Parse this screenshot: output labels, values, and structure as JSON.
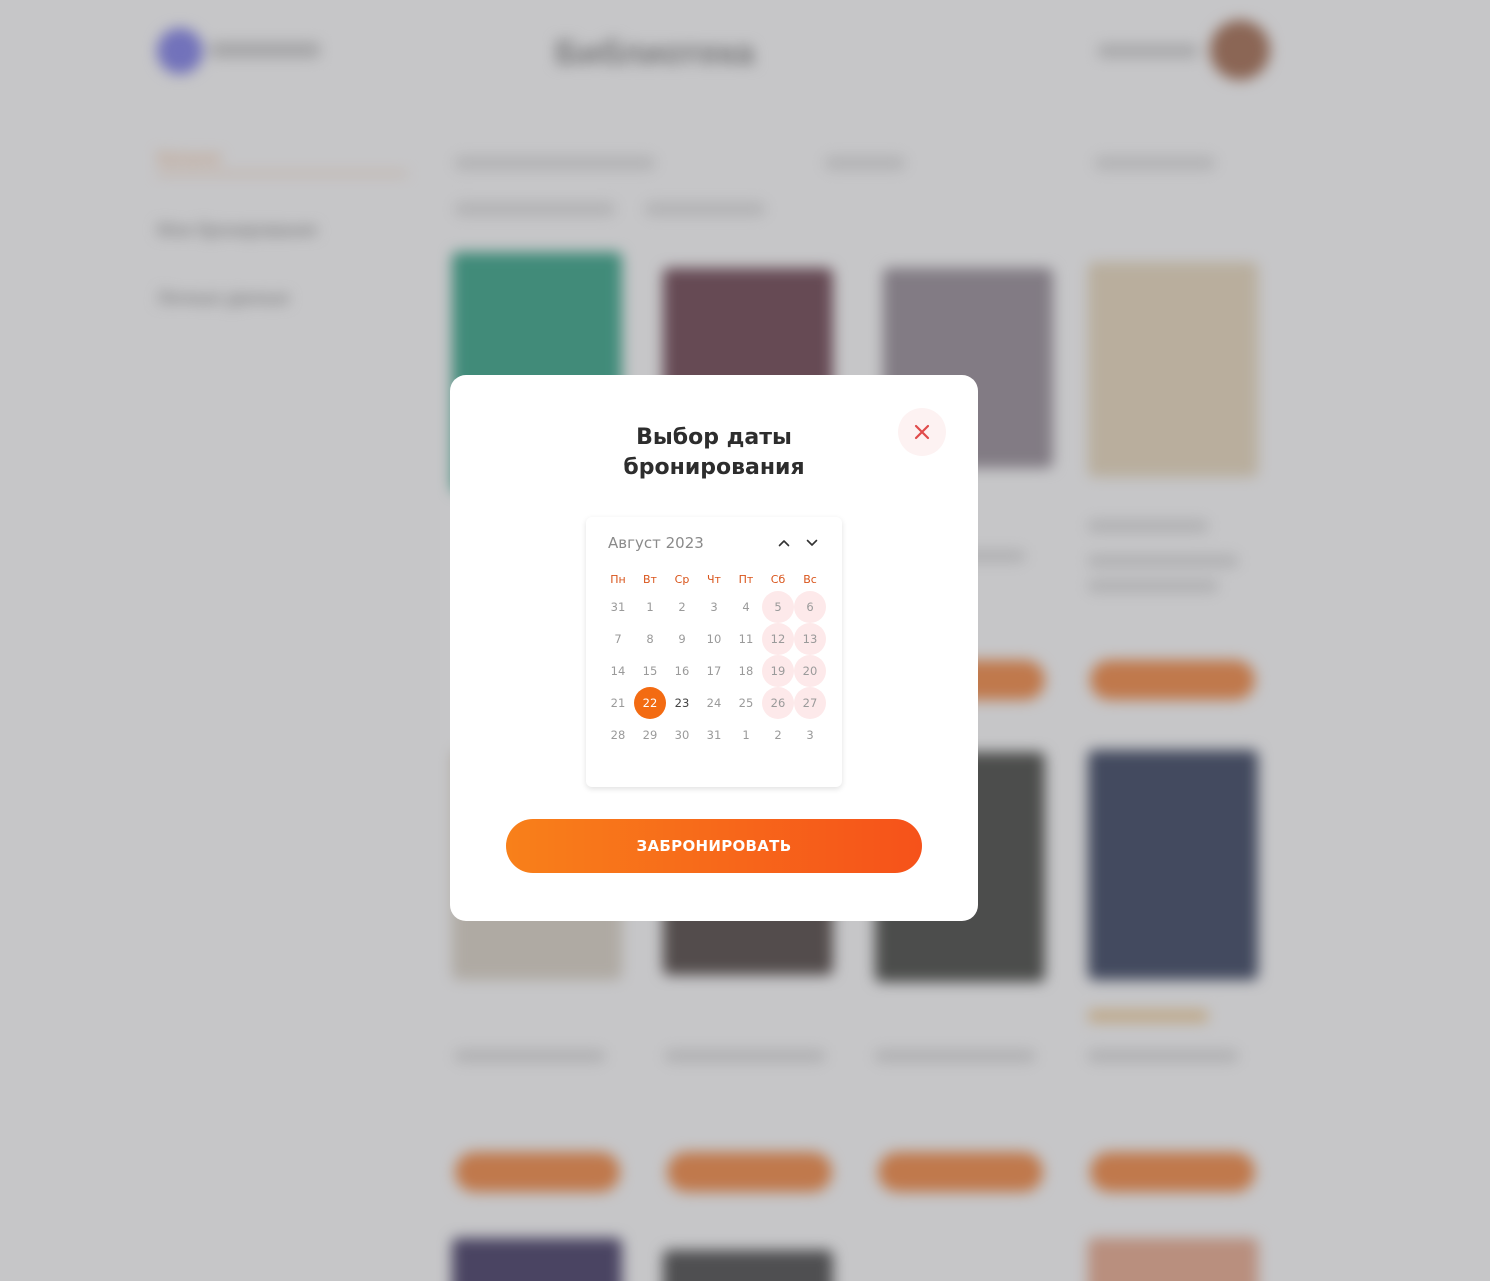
{
  "background": {
    "page_title": "Библиотека",
    "sidebar": [
      "Каталог",
      "Мои бронирования",
      "Личные данные"
    ]
  },
  "modal": {
    "title_line1": "Выбор даты",
    "title_line2": "бронирования",
    "close_icon": "close-icon",
    "button_label": "ЗАБРОНИРОВАТЬ"
  },
  "calendar": {
    "month_label": "Август 2023",
    "weekdays": [
      "Пн",
      "Вт",
      "Ср",
      "Чт",
      "Пт",
      "Сб",
      "Вс"
    ],
    "weeks": [
      [
        "31",
        "1",
        "2",
        "3",
        "4",
        "5",
        "6"
      ],
      [
        "7",
        "8",
        "9",
        "10",
        "11",
        "12",
        "13"
      ],
      [
        "14",
        "15",
        "16",
        "17",
        "18",
        "19",
        "20"
      ],
      [
        "21",
        "22",
        "23",
        "24",
        "25",
        "26",
        "27"
      ],
      [
        "28",
        "29",
        "30",
        "31",
        "1",
        "2",
        "3"
      ]
    ],
    "selected_day": "22",
    "available_day": "23"
  },
  "colors": {
    "accent": "#f36b12",
    "weekday_label": "#d9541a",
    "weekend_highlight": "#fde9ea",
    "close_icon": "#e04b4b"
  }
}
